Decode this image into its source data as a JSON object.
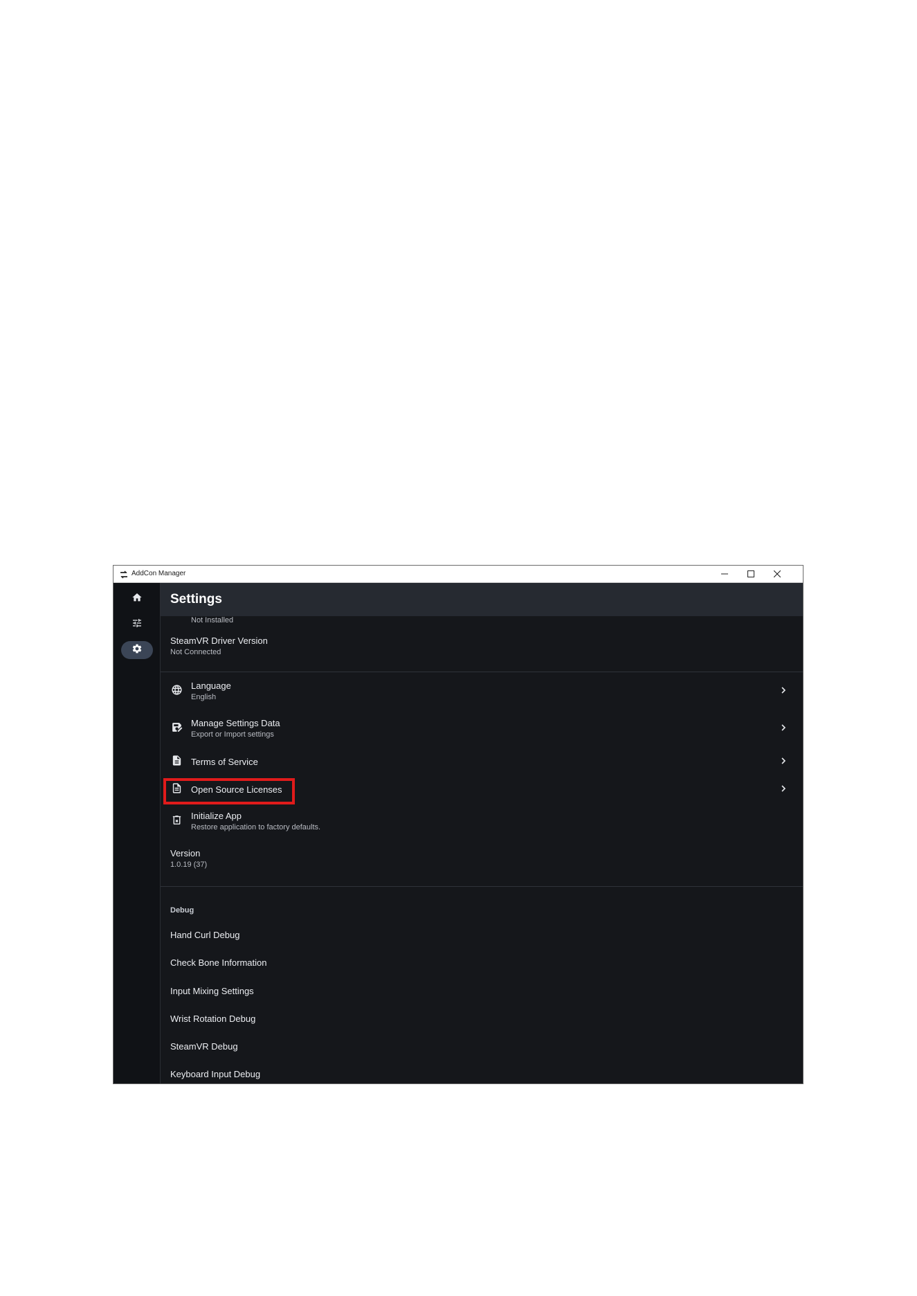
{
  "window": {
    "title": "AddCon Manager"
  },
  "sidebar": {
    "items": [
      {
        "name": "home",
        "icon": "home-icon",
        "active": false
      },
      {
        "name": "tune",
        "icon": "tune-icon",
        "active": false
      },
      {
        "name": "settings",
        "icon": "gear-icon",
        "active": true
      }
    ]
  },
  "header": {
    "title": "Settings"
  },
  "content": {
    "top_partial": {
      "subtitle": "Not Installed"
    },
    "driver": {
      "title": "SteamVR Driver Version",
      "subtitle": "Not Connected"
    },
    "language": {
      "title": "Language",
      "subtitle": "English"
    },
    "manage_settings": {
      "title": "Manage Settings Data",
      "subtitle": "Export or Import settings"
    },
    "terms": {
      "title": "Terms of Service"
    },
    "licenses": {
      "title": "Open Source Licenses"
    },
    "initialize": {
      "title": "Initialize App",
      "subtitle": "Restore application to factory defaults."
    },
    "version": {
      "title": "Version",
      "value": "1.0.19 (37)"
    },
    "debug": {
      "section_label": "Debug",
      "items": [
        "Hand Curl Debug",
        "Check Bone Information",
        "Input Mixing Settings",
        "Wrist Rotation Debug",
        "SteamVR Debug",
        "Keyboard Input Debug"
      ]
    }
  },
  "colors": {
    "background": "#15171b",
    "header": "#262a31",
    "sidebar": "#101216",
    "active_nav": "#3b4556",
    "highlight": "#e01b1b"
  }
}
